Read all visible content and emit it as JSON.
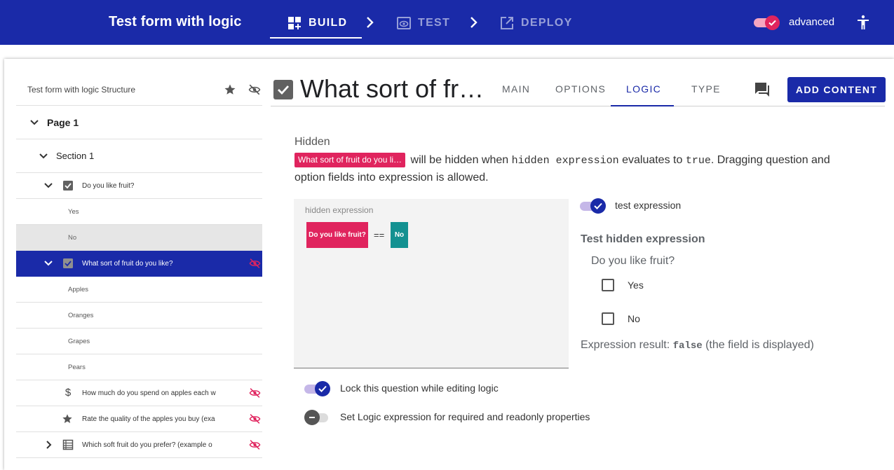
{
  "app": {
    "title": "Test form with logic",
    "steps": {
      "build": "BUILD",
      "test": "TEST",
      "deploy": "DEPLOY"
    },
    "advanced_label": "advanced",
    "accent": "#1a2aa8",
    "pink": "#e0245e",
    "teal": "#139191"
  },
  "structure": {
    "title": "Test form with logic Structure",
    "page": "Page 1",
    "section": "Section 1",
    "questions": [
      {
        "label": "Do you like fruit?",
        "type_icon": "checkbox-icon",
        "options": [
          "Yes",
          "No"
        ]
      },
      {
        "label": "What sort of fruit do you like?",
        "type_icon": "checkbox-icon",
        "options": [
          "Apples",
          "Oranges",
          "Grapes",
          "Pears"
        ]
      },
      {
        "label": "How much do you spend on apples each w",
        "type_icon": "dollar-icon"
      },
      {
        "label": "Rate the quality of the apples you buy (exa",
        "type_icon": "star-icon"
      },
      {
        "label": "Which soft fruit do you prefer? (example o",
        "type_icon": "grid-icon"
      }
    ]
  },
  "question": {
    "title": "What sort of fr…",
    "tabs": {
      "main": "MAIN",
      "options": "OPTIONS",
      "logic": "LOGIC",
      "type": "TYPE"
    },
    "active_tab": "LOGIC",
    "add_content": "ADD CONTENT"
  },
  "logic": {
    "hidden_label": "Hidden",
    "chip": "What sort of fruit do you li…",
    "desc_1": " will be hidden when ",
    "desc_code_1": "hidden expression",
    "desc_2": " evaluates to ",
    "desc_code_2": "true",
    "desc_3": ". Dragging question and option fields into expression is allowed.",
    "expr_label": "hidden expression",
    "expr_question": "Do you like fruit?",
    "expr_operator": "==",
    "expr_value": "No",
    "test_toggle_label": "test expression",
    "test_title": "Test hidden expression",
    "test_question": "Do you like fruit?",
    "test_options": [
      "Yes",
      "No"
    ],
    "result_prefix": "Expression result: ",
    "result_value": "false",
    "result_suffix": " (the field is displayed)",
    "lock_label": "Lock this question while editing logic",
    "req_label": "Set Logic expression for required and readonly properties"
  }
}
